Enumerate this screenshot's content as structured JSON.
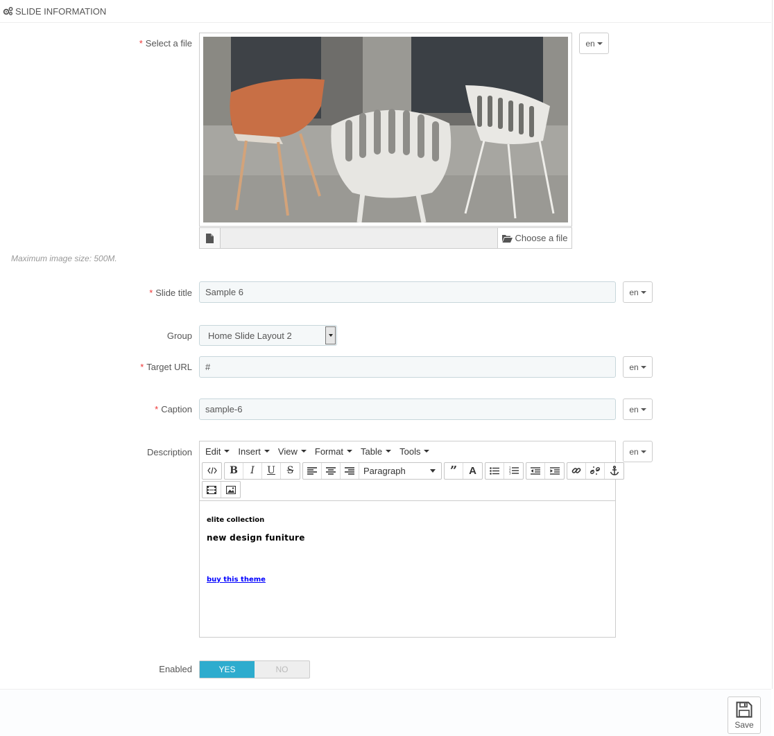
{
  "header": {
    "title": "SLIDE INFORMATION"
  },
  "fields": {
    "file": {
      "label": "Select a file",
      "choose_label": "Choose a file",
      "hint": "Maximum image size: 500M."
    },
    "slide_title": {
      "label": "Slide title",
      "value": "Sample 6"
    },
    "group": {
      "label": "Group",
      "value": "Home Slide Layout 2"
    },
    "target_url": {
      "label": "Target URL",
      "value": "#"
    },
    "caption": {
      "label": "Caption",
      "value": "sample-6"
    },
    "description": {
      "label": "Description"
    },
    "enabled": {
      "label": "Enabled",
      "yes": "YES",
      "no": "NO",
      "value": "YES"
    }
  },
  "lang": {
    "code": "en"
  },
  "editor": {
    "menus": [
      "Edit",
      "Insert",
      "View",
      "Format",
      "Table",
      "Tools"
    ],
    "block_format": "Paragraph",
    "content": {
      "line1": "elite collection",
      "line2": "new design funiture",
      "link": "buy this theme"
    }
  },
  "footer": {
    "save_label": "Save"
  },
  "colors": {
    "accent": "#2eacce",
    "required": "#e33333",
    "link": "#0000ff"
  }
}
